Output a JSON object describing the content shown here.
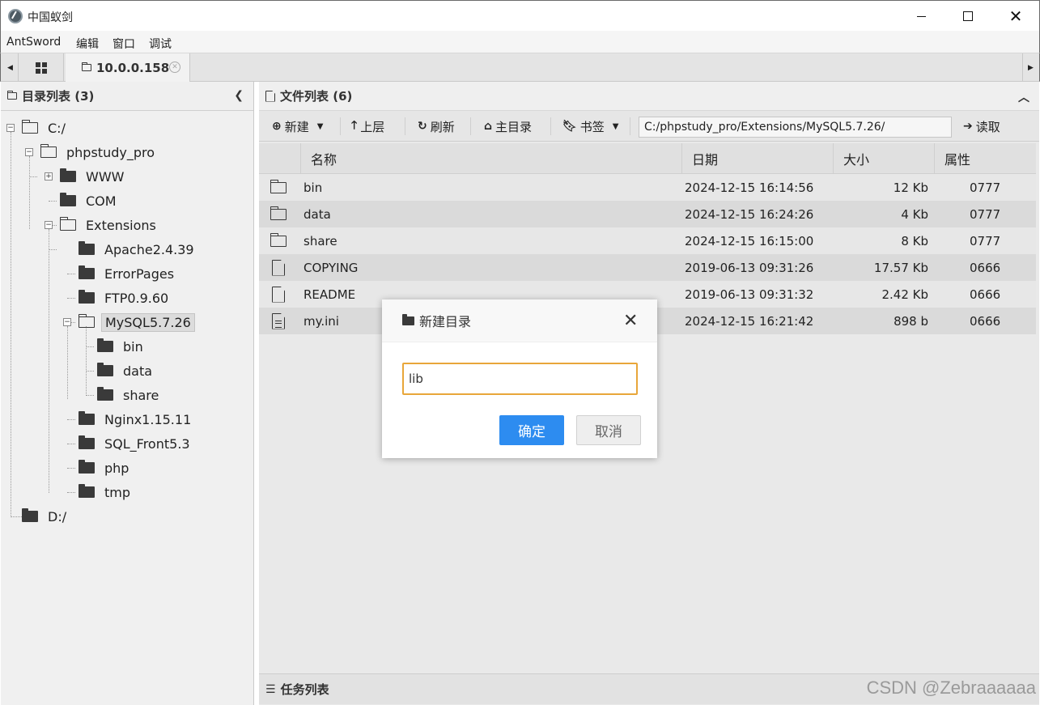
{
  "window": {
    "title": "中国蚁剑",
    "minimize": "–",
    "maximize": "□",
    "close": "✕"
  },
  "menu": [
    "AntSword",
    "编辑",
    "窗口",
    "调试"
  ],
  "tabs": {
    "host": "10.0.0.158",
    "close": "✕"
  },
  "left_panel": {
    "title": "目录列表 (3)",
    "tree": [
      {
        "label": "C:/",
        "expanded": true
      },
      {
        "label": "phpstudy_pro",
        "expanded": true
      },
      {
        "label": "WWW",
        "expanded": false
      },
      {
        "label": "COM"
      },
      {
        "label": "Extensions",
        "expanded": true
      },
      {
        "label": "Apache2.4.39"
      },
      {
        "label": "ErrorPages"
      },
      {
        "label": "FTP0.9.60"
      },
      {
        "label": "MySQL5.7.26",
        "expanded": true,
        "selected": true
      },
      {
        "label": "bin"
      },
      {
        "label": "data"
      },
      {
        "label": "share"
      },
      {
        "label": "Nginx1.15.11"
      },
      {
        "label": "SQL_Front5.3"
      },
      {
        "label": "php"
      },
      {
        "label": "tmp"
      },
      {
        "label": "D:/"
      }
    ]
  },
  "right_panel": {
    "title": "文件列表 (6)",
    "toolbar": {
      "new": "新建",
      "up": "上层",
      "refresh": "刷新",
      "home": "主目录",
      "bookmarks": "书签",
      "path": "C:/phpstudy_pro/Extensions/MySQL5.7.26/",
      "read": "读取"
    },
    "columns": [
      "名称",
      "日期",
      "大小",
      "属性"
    ],
    "files": [
      {
        "type": "folder",
        "name": "bin",
        "date": "2024-12-15 16:14:56",
        "size": "12 Kb",
        "attr": "0777"
      },
      {
        "type": "folder",
        "name": "data",
        "date": "2024-12-15 16:24:26",
        "size": "4 Kb",
        "attr": "0777"
      },
      {
        "type": "folder",
        "name": "share",
        "date": "2024-12-15 16:15:00",
        "size": "8 Kb",
        "attr": "0777"
      },
      {
        "type": "file",
        "name": "COPYING",
        "date": "2019-06-13 09:31:26",
        "size": "17.57 Kb",
        "attr": "0666"
      },
      {
        "type": "file",
        "name": "README",
        "date": "2019-06-13 09:31:32",
        "size": "2.42 Kb",
        "attr": "0666"
      },
      {
        "type": "text-file",
        "name": "my.ini",
        "date": "2024-12-15 16:21:42",
        "size": "898 b",
        "attr": "0666"
      }
    ]
  },
  "taskbar": {
    "title": "任务列表",
    "watermark": "CSDN @Zebraaaaaa"
  },
  "dialog": {
    "title": "新建目录",
    "input_value": "lib",
    "ok": "确定",
    "cancel": "取消",
    "close": "✕"
  },
  "colors": {
    "accent": "#2d8cf0",
    "input_focus_border": "#e8a63a"
  }
}
